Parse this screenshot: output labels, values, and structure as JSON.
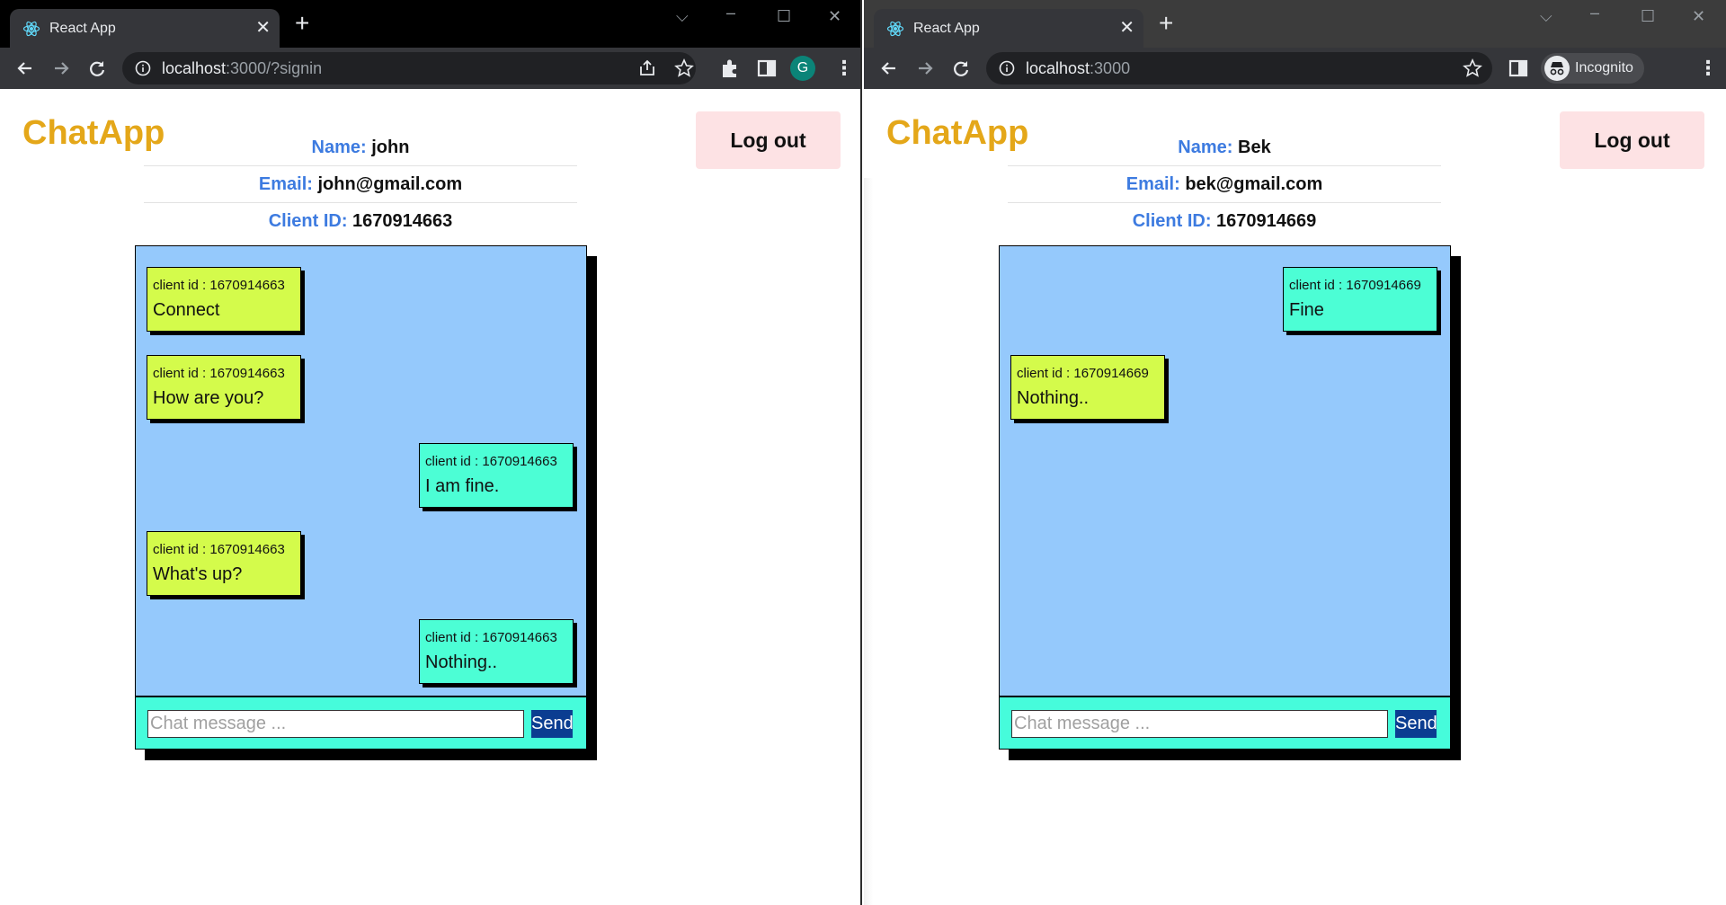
{
  "colors": {
    "brand": "#e4a719",
    "label": "#3d7be0",
    "chat_bg": "#95c9fc",
    "msg_mine": "#d4fb4b",
    "msg_theirs": "#4cfed5",
    "footer": "#46fcdb",
    "send_btn": "#0b3d91",
    "logout_bg": "#fde2e4"
  },
  "left": {
    "tab_title": "React App",
    "url_host": "localhost",
    "url_rest": ":3000/?signin",
    "profile_initial": "G",
    "app_title": "ChatApp",
    "logout_label": "Log out",
    "name_label": "Name:",
    "name_value": "john",
    "email_label": "Email:",
    "email_value": "john@gmail.com",
    "client_label": "Client ID:",
    "client_value": "1670914663",
    "messages": [
      {
        "client": "client id : 1670914663",
        "text": "Connect"
      },
      {
        "client": "client id : 1670914663",
        "text": "How are you?"
      },
      {
        "client": "client id : 1670914663",
        "text": "I am fine."
      },
      {
        "client": "client id : 1670914663",
        "text": "What's up?"
      },
      {
        "client": "client id : 1670914663",
        "text": "Nothing.."
      }
    ],
    "input_placeholder": "Chat message ...",
    "send_label": "Send"
  },
  "right": {
    "tab_title": "React App",
    "url_host": "localhost",
    "url_rest": ":3000",
    "incognito_label": "Incognito",
    "app_title": "ChatApp",
    "logout_label": "Log out",
    "name_label": "Name:",
    "name_value": "Bek",
    "email_label": "Email:",
    "email_value": "bek@gmail.com",
    "client_label": "Client ID:",
    "client_value": "1670914669",
    "messages": [
      {
        "client": "client id : 1670914669",
        "text": "Fine"
      },
      {
        "client": "client id : 1670914669",
        "text": "Nothing.."
      }
    ],
    "input_placeholder": "Chat message ...",
    "send_label": "Send"
  }
}
